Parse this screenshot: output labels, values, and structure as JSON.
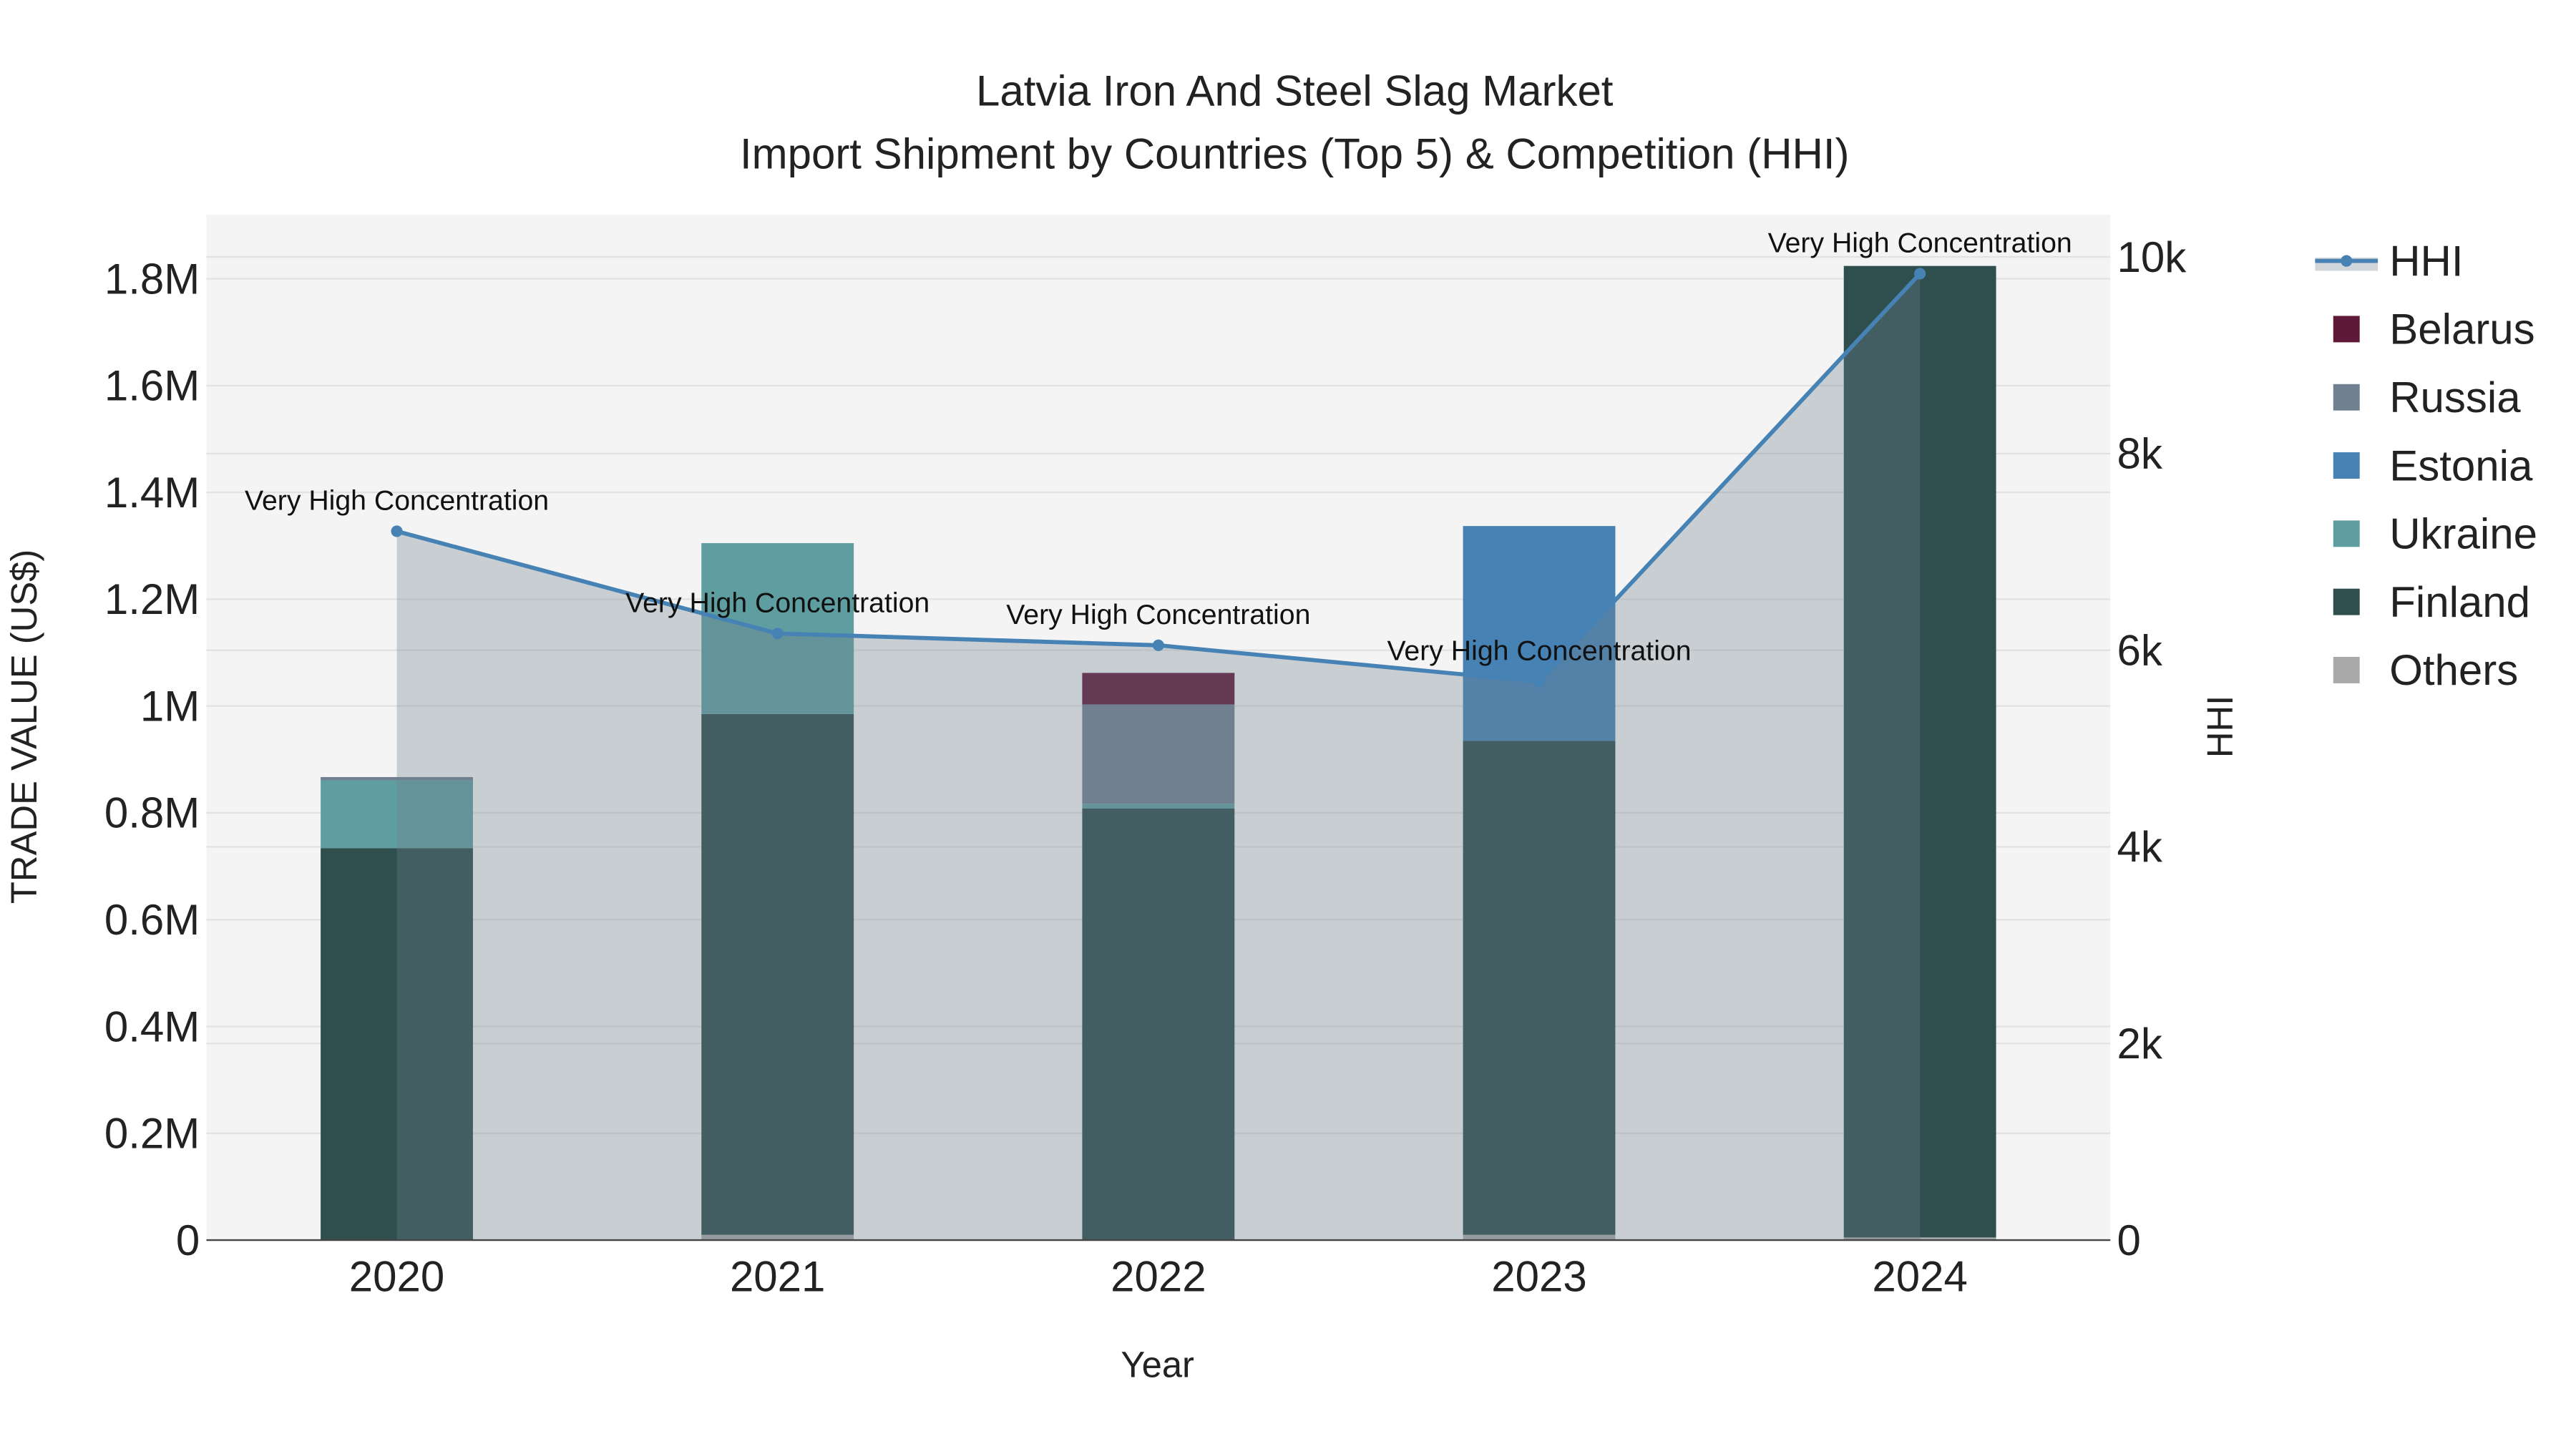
{
  "chart_data": {
    "type": "bar",
    "title": "Latvia Iron And Steel Slag Market",
    "subtitle": "Import Shipment by Countries (Top 5) & Competition (HHI)",
    "xlabel": "Year",
    "ylabel": "TRADE VALUE (US$)",
    "y2label": "HHI",
    "categories": [
      "2020",
      "2021",
      "2022",
      "2023",
      "2024"
    ],
    "ylim": [
      0,
      1920000
    ],
    "y2lim": [
      0,
      10430
    ],
    "yticks": [
      0,
      200000,
      400000,
      600000,
      800000,
      1000000,
      1200000,
      1400000,
      1600000,
      1800000
    ],
    "ytick_labels": [
      "0",
      "0.2M",
      "0.4M",
      "0.6M",
      "0.8M",
      "1M",
      "1.2M",
      "1.4M",
      "1.6M",
      "1.8M"
    ],
    "y2ticks": [
      0,
      2000,
      4000,
      6000,
      8000,
      10000
    ],
    "y2tick_labels": [
      "0",
      "2k",
      "4k",
      "6k",
      "8k",
      "10k"
    ],
    "grid": true,
    "barmode": "stack",
    "series": [
      {
        "name": "Others",
        "color": "#A9A9A9",
        "values": [
          0,
          10000,
          0,
          10000,
          5000
        ]
      },
      {
        "name": "Finland",
        "color": "#2F4F4F",
        "values": [
          734000,
          975000,
          808000,
          925000,
          1819000
        ]
      },
      {
        "name": "Ukraine",
        "color": "#5F9EA0",
        "values": [
          127000,
          320000,
          9000,
          0,
          0
        ]
      },
      {
        "name": "Estonia",
        "color": "#4682B4",
        "values": [
          0,
          0,
          0,
          402000,
          0
        ]
      },
      {
        "name": "Russia",
        "color": "#708090",
        "values": [
          6000,
          0,
          186000,
          0,
          0
        ]
      },
      {
        "name": "Belarus",
        "color": "#5E1939",
        "values": [
          0,
          0,
          59000,
          0,
          0
        ]
      }
    ],
    "hhi": {
      "name": "HHI",
      "color": "#4682B4",
      "values": [
        7210,
        6170,
        6050,
        5680,
        9830
      ],
      "annotations": [
        "Very High Concentration",
        "Very High Concentration",
        "Very High Concentration",
        "Very High Concentration",
        "Very High Concentration"
      ]
    },
    "legend": {
      "position": "right",
      "items": [
        "HHI",
        "Belarus",
        "Russia",
        "Estonia",
        "Ukraine",
        "Finland",
        "Others"
      ]
    }
  }
}
